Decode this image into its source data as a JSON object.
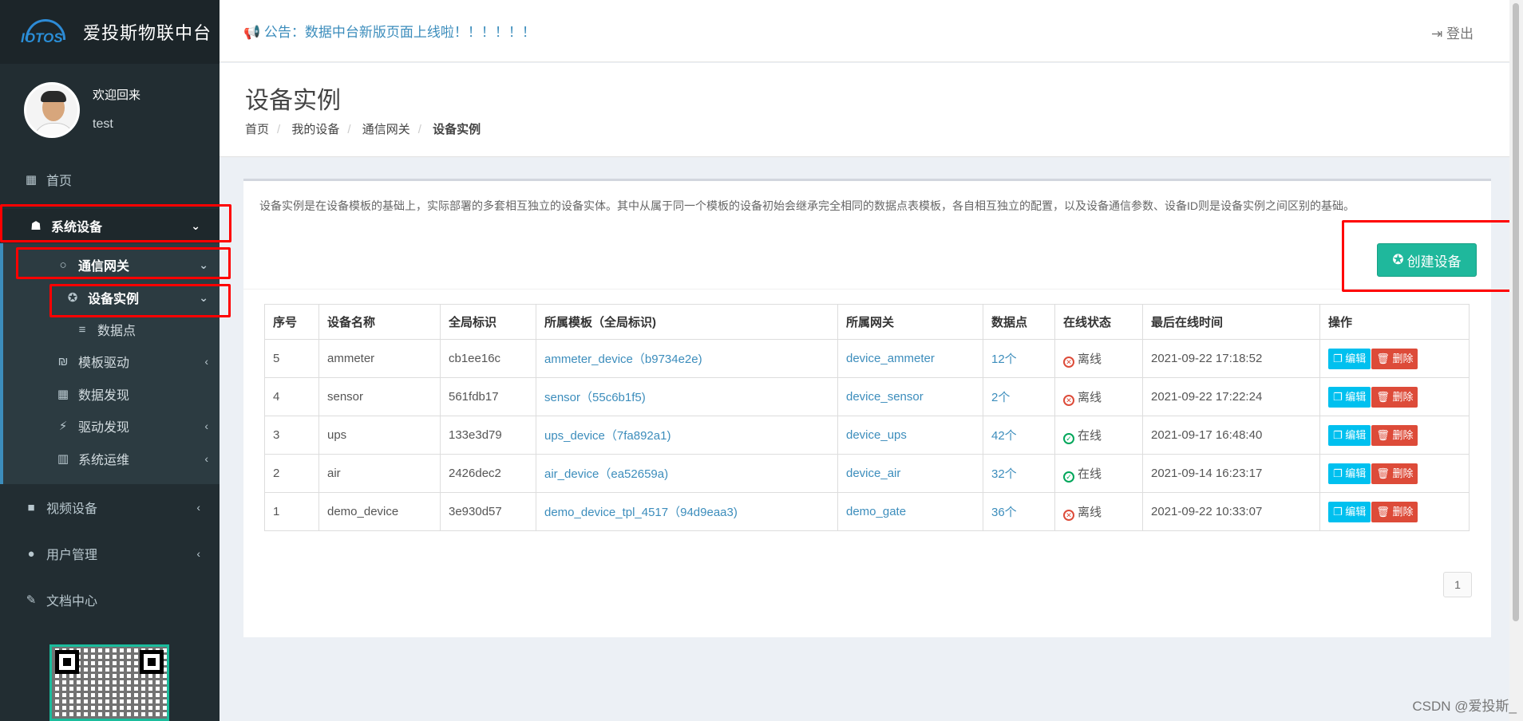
{
  "brand": {
    "logo_text": "IOTOS",
    "title": "爱投斯物联中台"
  },
  "user": {
    "welcome": "欢迎回来",
    "name": "test"
  },
  "sidebar": {
    "home": "首页",
    "system_devices": "系统设备",
    "gateway": "通信网关",
    "device_instance": "设备实例",
    "data_points": "数据点",
    "template_driver": "模板驱动",
    "data_discovery": "数据发现",
    "driver_discovery": "驱动发现",
    "system_ops": "系统运维",
    "video_devices": "视频设备",
    "user_management": "用户管理",
    "doc_center": "文档中心"
  },
  "header": {
    "notice": "公告：数据中台新版页面上线啦！！！！！！",
    "logout": "登出"
  },
  "page": {
    "title": "设备实例",
    "breadcrumb": [
      "首页",
      "我的设备",
      "通信网关",
      "设备实例"
    ]
  },
  "box": {
    "description": "设备实例是在设备模板的基础上，实际部署的多套相互独立的设备实体。其中从属于同一个模板的设备初始会继承完全相同的数据点表模板，各自相互独立的配置，以及设备通信参数、设备ID则是设备实例之间区别的基础。",
    "create_button": "创建设备"
  },
  "table": {
    "headers": [
      "序号",
      "设备名称",
      "全局标识",
      "所属模板（全局标识)",
      "所属网关",
      "数据点",
      "在线状态",
      "最后在线时间",
      "操作"
    ],
    "rows": [
      {
        "seq": "5",
        "name": "ammeter",
        "id": "cb1ee16c",
        "template": "ammeter_device（b9734e2e)",
        "gateway": "device_ammeter",
        "points": "12个",
        "status": "离线",
        "online": false,
        "last": "2021-09-22 17:18:52"
      },
      {
        "seq": "4",
        "name": "sensor",
        "id": "561fdb17",
        "template": "sensor（55c6b1f5)",
        "gateway": "device_sensor",
        "points": "2个",
        "status": "离线",
        "online": false,
        "last": "2021-09-22 17:22:24"
      },
      {
        "seq": "3",
        "name": "ups",
        "id": "133e3d79",
        "template": "ups_device（7fa892a1)",
        "gateway": "device_ups",
        "points": "42个",
        "status": "在线",
        "online": true,
        "last": "2021-09-17 16:48:40"
      },
      {
        "seq": "2",
        "name": "air",
        "id": "2426dec2",
        "template": "air_device（ea52659a)",
        "gateway": "device_air",
        "points": "32个",
        "status": "在线",
        "online": true,
        "last": "2021-09-14 16:23:17"
      },
      {
        "seq": "1",
        "name": "demo_device",
        "id": "3e930d57",
        "template": "demo_device_tpl_4517（94d9eaa3)",
        "gateway": "demo_gate",
        "points": "36个",
        "status": "离线",
        "online": false,
        "last": "2021-09-22 10:33:07"
      }
    ],
    "edit_label": "编辑",
    "delete_label": "删除"
  },
  "pagination": {
    "page": "1"
  },
  "watermark": "CSDN @爱投斯_"
}
